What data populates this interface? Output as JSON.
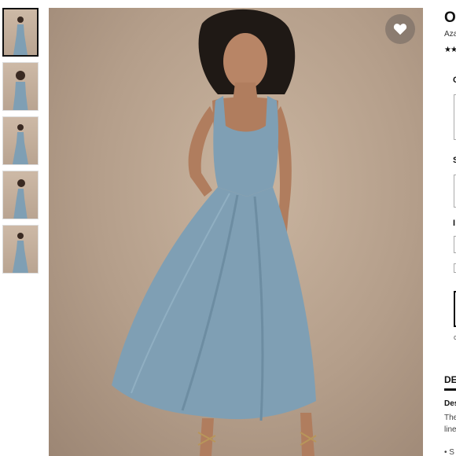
{
  "thumbnails": [
    {
      "alt": "dress front view"
    },
    {
      "alt": "dress side view"
    },
    {
      "alt": "dress full front"
    },
    {
      "alt": "dress side profile"
    },
    {
      "alt": "dress back view"
    }
  ],
  "hero": {
    "alt": "model wearing dusty blue tea-length dress"
  },
  "product": {
    "title": "O",
    "brand": "Aza",
    "rating_stars": "★★"
  },
  "sections": {
    "color_label": "C",
    "size_label": "S",
    "extra_label": "I",
    "note_text": "c"
  },
  "description": {
    "tab": "DE",
    "heading": "Des",
    "line1": "The",
    "line2": "line",
    "bullet": "• S"
  },
  "colors": {
    "dress": "#7f9fb4",
    "background": "#b9a38f",
    "accent": "#111111"
  },
  "icons": {
    "favorite": "heart-icon"
  }
}
